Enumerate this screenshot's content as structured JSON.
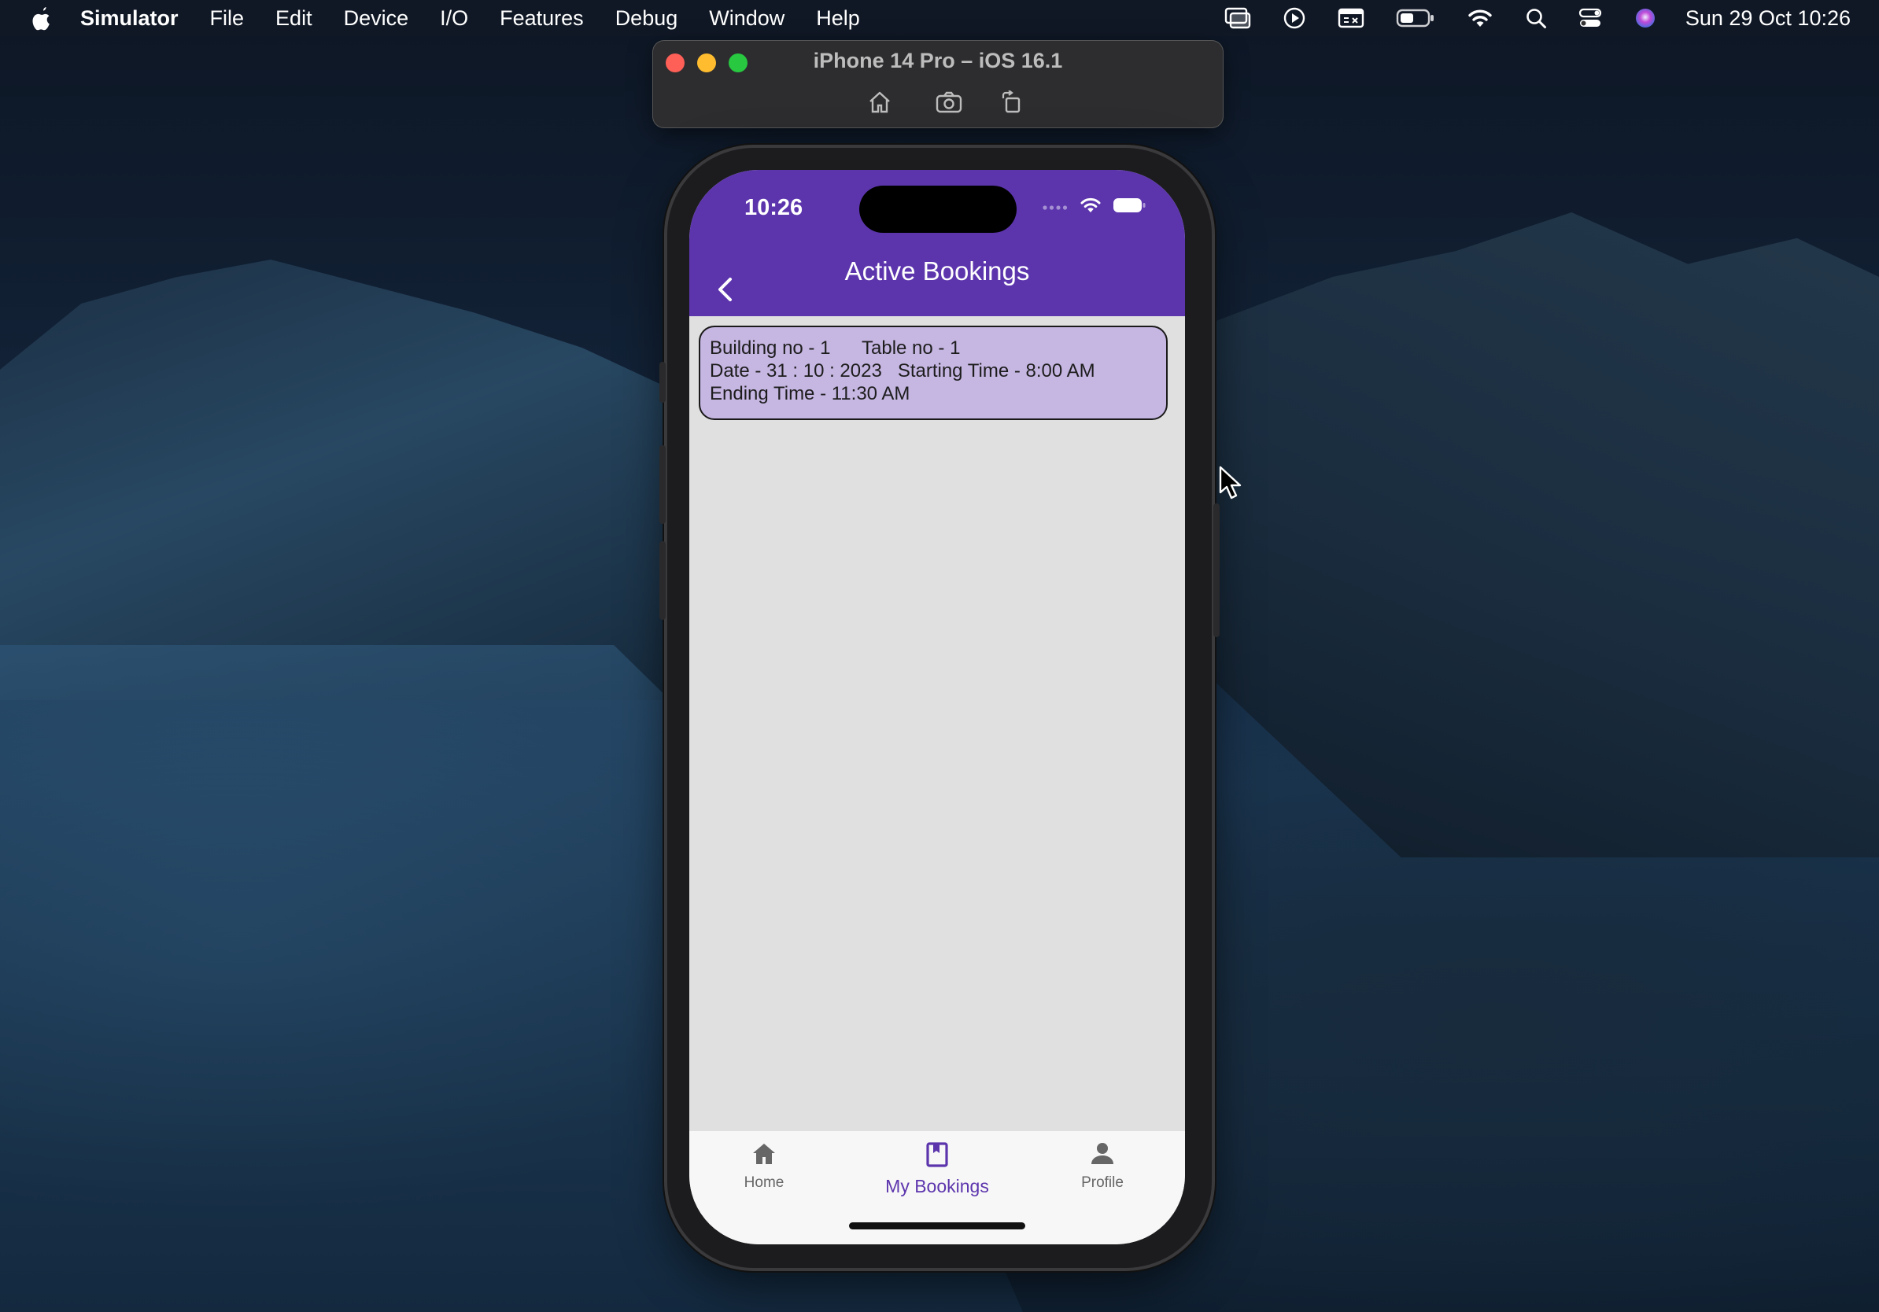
{
  "menubar": {
    "app_name": "Simulator",
    "items": [
      "File",
      "Edit",
      "Device",
      "I/O",
      "Features",
      "Debug",
      "Window",
      "Help"
    ],
    "clock": "Sun 29 Oct  10:26",
    "status_icons": [
      "screen-mirroring-icon",
      "play-icon",
      "keyboard-brightness-icon",
      "battery-icon",
      "wifi-icon",
      "search-icon",
      "control-center-icon",
      "siri-icon"
    ]
  },
  "simulator": {
    "title": "iPhone 14 Pro – iOS 16.1",
    "tools": [
      "home-icon",
      "screenshot-icon",
      "rotate-icon"
    ]
  },
  "phone": {
    "status_time": "10:26",
    "title": "Active Bookings",
    "booking": {
      "line1": "Building no - 1      Table no - 1",
      "line2": "Date - 31 : 10 : 2023   Starting Time - 8:00 AM",
      "line3": "Ending Time - 11:30 AM"
    },
    "nav": [
      {
        "label": "Home",
        "icon": "home-icon"
      },
      {
        "label": "My Bookings",
        "icon": "bookmark-icon",
        "active": true
      },
      {
        "label": "Profile",
        "icon": "person-icon"
      }
    ]
  },
  "colors": {
    "accent": "#5c35ad",
    "card": "#c6b6e2",
    "screen_bg": "#e0e0e0",
    "traffic_red": "#fe5f57",
    "traffic_yellow": "#febc2e",
    "traffic_green": "#28c840"
  }
}
